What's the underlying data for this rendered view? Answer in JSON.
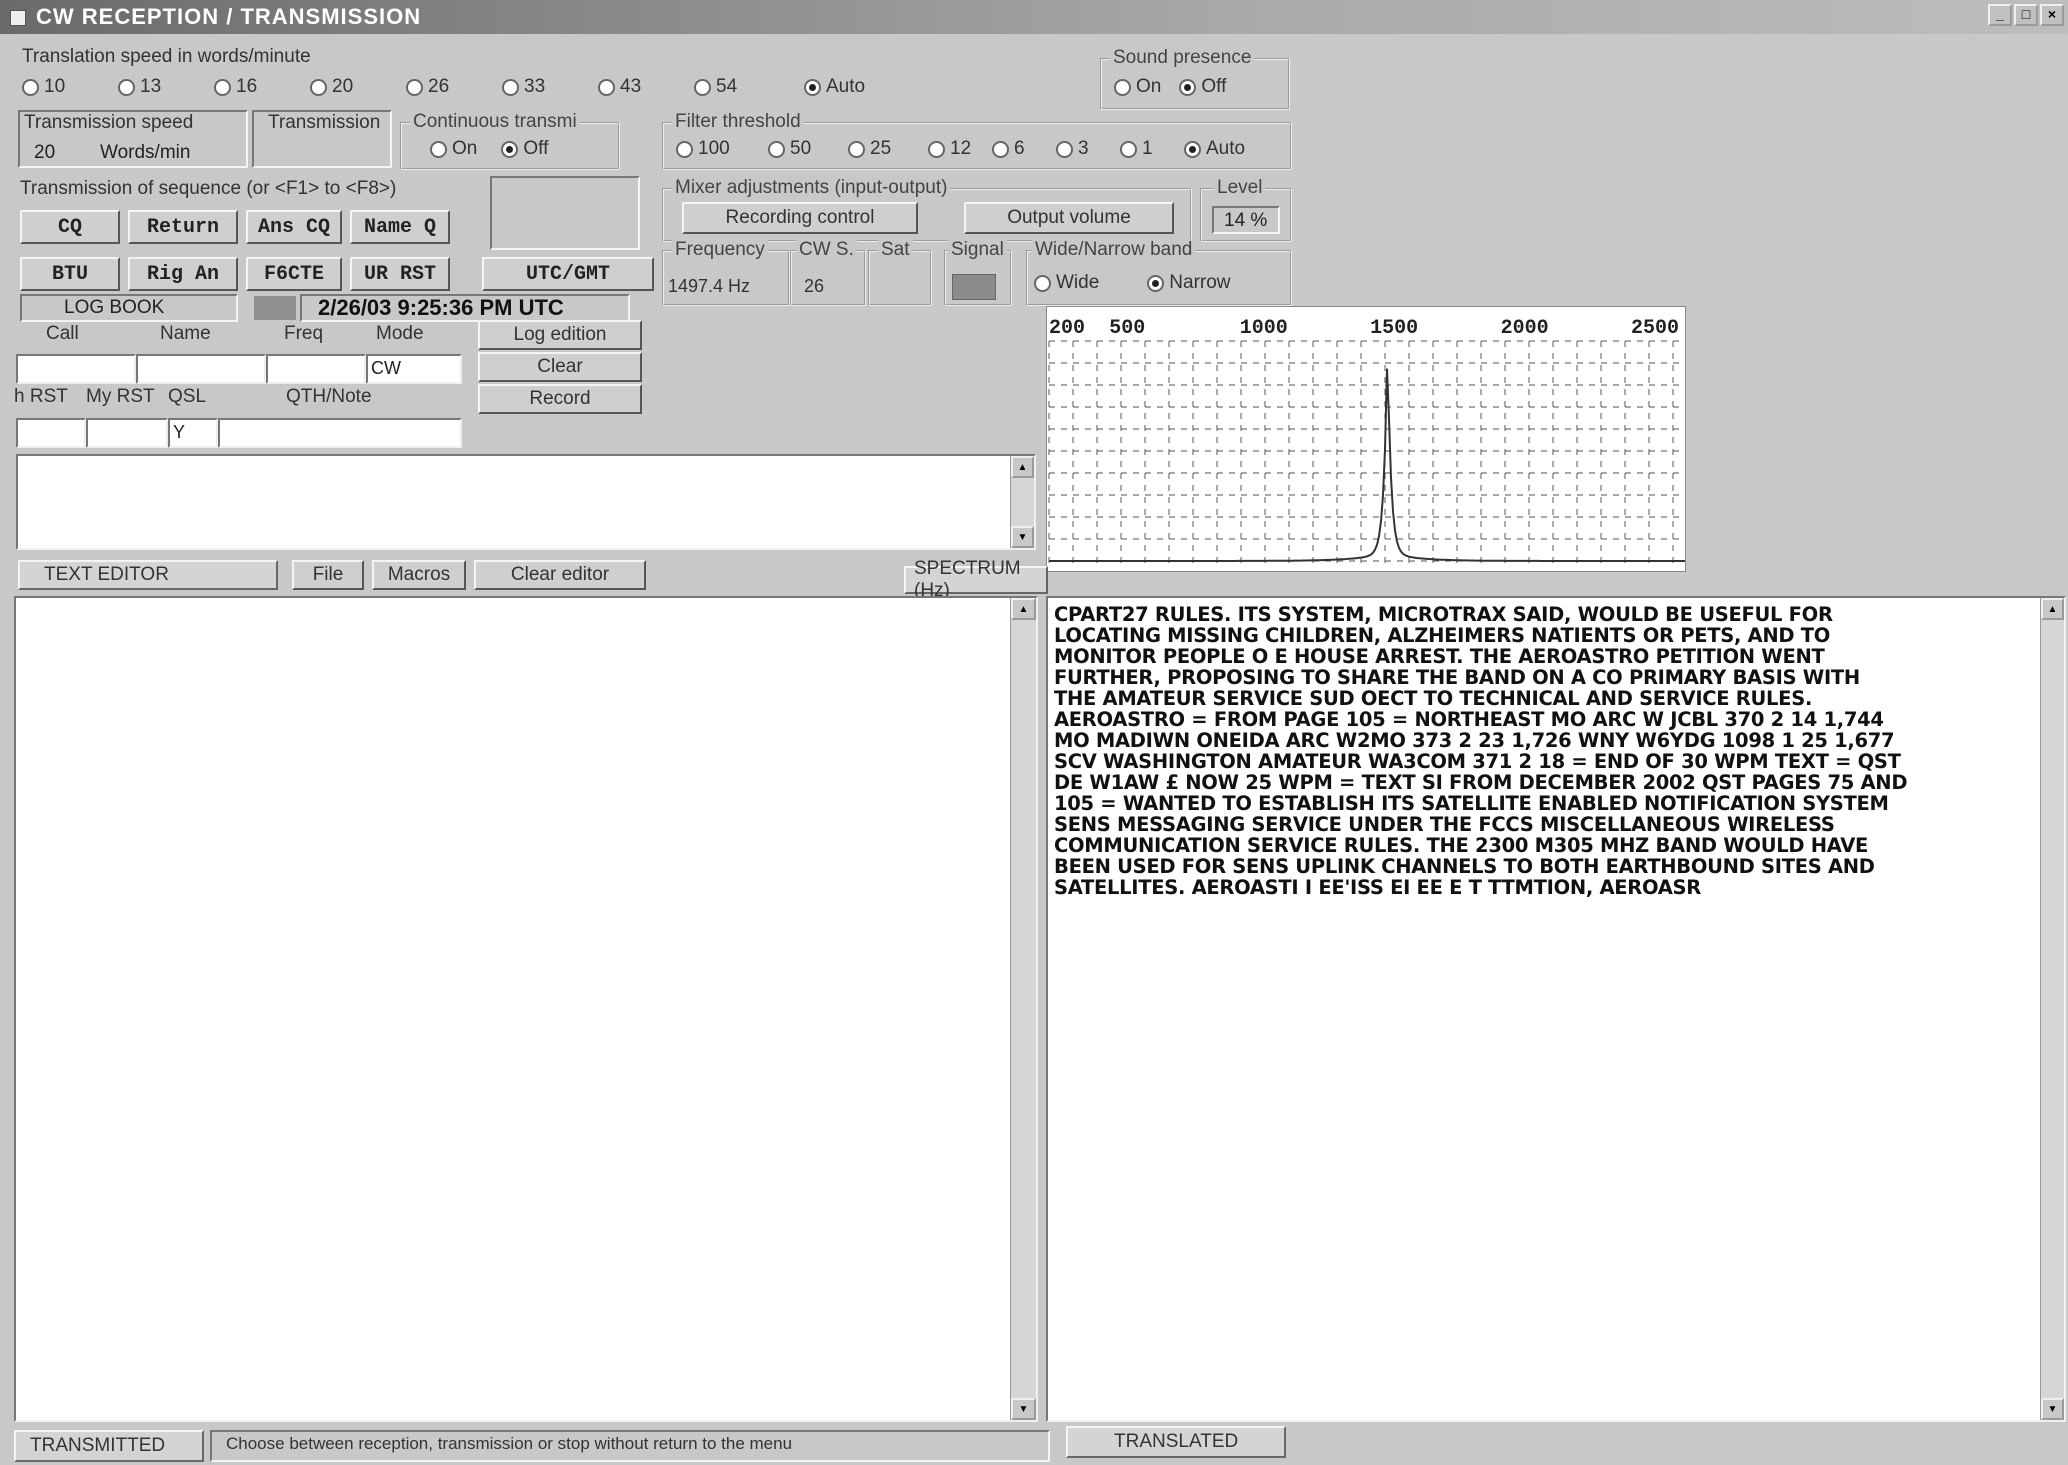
{
  "window": {
    "title": "CW RECEPTION / TRANSMISSION",
    "controls": [
      "_",
      "□",
      "×"
    ]
  },
  "translation_speed": {
    "label": "Translation speed in words/minute",
    "options": [
      "10",
      "13",
      "16",
      "20",
      "26",
      "33",
      "43",
      "54",
      "Auto"
    ],
    "selected": "Auto"
  },
  "sound_presence": {
    "label": "Sound presence",
    "options": [
      "On",
      "Off"
    ],
    "selected": "Off"
  },
  "transmission_speed": {
    "label": "Transmission speed",
    "value": "20",
    "unit": "Words/min"
  },
  "transmission": {
    "label": "Transmission"
  },
  "continuous": {
    "label": "Continuous transmi",
    "options": [
      "On",
      "Off"
    ],
    "selected": "Off"
  },
  "filter_threshold": {
    "label": "Filter threshold",
    "options": [
      "100",
      "50",
      "25",
      "12",
      "6",
      "3",
      "1",
      "Auto"
    ],
    "selected": "Auto"
  },
  "sequence": {
    "label": "Transmission of sequence (or <F1> to <F8>)",
    "row1": [
      "CQ",
      "Return",
      "Ans CQ",
      "Name Q"
    ],
    "row2": [
      "BTU",
      "Rig An",
      "F6CTE",
      "UR RST"
    ],
    "utc_button": "UTC/GMT"
  },
  "mixer": {
    "label": "Mixer adjustments (input-output)",
    "recording": "Recording control",
    "output": "Output volume"
  },
  "level": {
    "label": "Level",
    "value": "14 %"
  },
  "frequency": {
    "label": "Frequency",
    "value": "1497.4 Hz"
  },
  "cws": {
    "label": "CW S.",
    "value": "26"
  },
  "sat": {
    "label": "Sat"
  },
  "signal": {
    "label": "Signal"
  },
  "band": {
    "label": "Wide/Narrow band",
    "options": [
      "Wide",
      "Narrow"
    ],
    "selected": "Narrow"
  },
  "logbook": {
    "label": "LOG BOOK",
    "datetime": "2/26/03 9:25:36 PM UTC",
    "headers": [
      "Call",
      "Name",
      "Freq",
      "Mode"
    ],
    "mode_value": "CW",
    "headers2": [
      "h RST",
      "My RST",
      "QSL",
      "QTH/Note"
    ],
    "qsl_value": "Y",
    "buttons": [
      "Log edition",
      "Clear",
      "Record"
    ]
  },
  "spectrum": {
    "ticks": [
      "200",
      "500",
      "1000",
      "1500",
      "2000",
      "2500"
    ],
    "label": "SPECTRUM (Hz)"
  },
  "editor": {
    "label": "TEXT EDITOR",
    "buttons": [
      "File",
      "Macros",
      "Clear editor"
    ]
  },
  "received_text": "CPART27 RULES. ITS SYSTEM, MICROTRAX SAID, WOULD BE USEFUL FOR\nLOCATING MISSING CHILDREN, ALZHEIMERS NATIENTS OR PETS, AND TO\nMONITOR PEOPLE O E HOUSE ARREST. THE AEROASTRO PETITION WENT\nFURTHER, PROPOSING TO SHARE THE BAND ON A CO PRIMARY BASIS WITH\nTHE AMATEUR SERVICE SUD OECT TO TECHNICAL AND SERVICE RULES.\nAEROASTRO = FROM PAGE 105 = NORTHEAST MO ARC W JCBL 370 2 14 1,744\nMO MADIWN ONEIDA ARC W2MO 373 2 23 1,726 WNY W6YDG 1098 1 25 1,677\nSCV WASHINGTON AMATEUR WA3COM 371 2 18 = END OF 30 WPM TEXT = QST\nDE W1AW £ NOW 25 WPM = TEXT SI FROM DECEMBER 2002 QST PAGES 75 AND\n105 = WANTED TO ESTABLISH ITS SATELLITE ENABLED NOTIFICATION SYSTEM\nSENS MESSAGING SERVICE UNDER THE FCCS MISCELLANEOUS WIRELESS\nCOMMUNICATION SERVICE RULES. THE 2300 M305 MHZ BAND WOULD HAVE\nBEEN USED FOR SENS UPLINK CHANNELS TO BOTH EARTHBOUND SITES AND\nSATELLITES. AEROASTI I EE'ISS EI EE E T TTMTION, AEROASR",
  "status": {
    "transmitted": "TRANSMITTED",
    "hint": "Choose between reception, transmission or stop without return to the menu",
    "translated": "TRANSLATED"
  }
}
